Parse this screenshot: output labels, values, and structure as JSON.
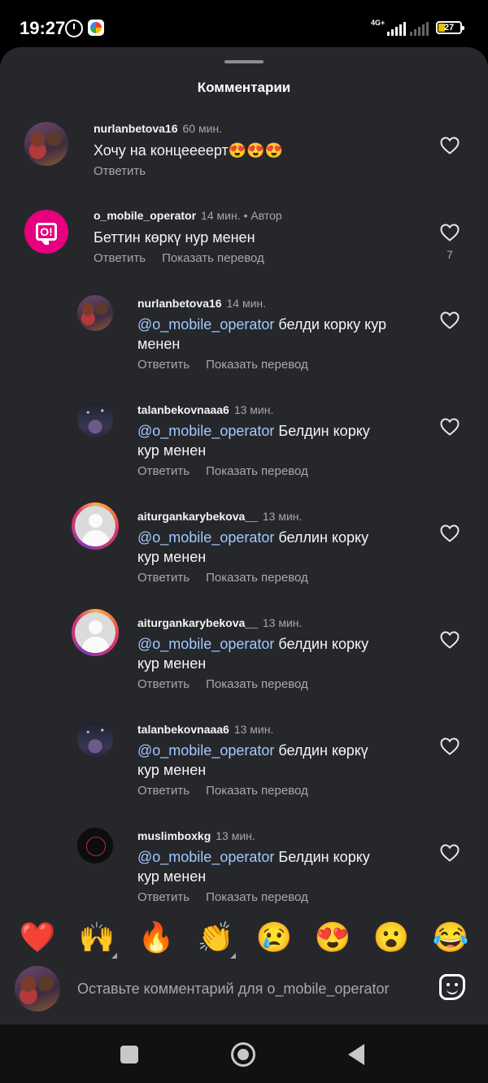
{
  "status_bar": {
    "time": "19:27",
    "network": "4G+",
    "battery": "27",
    "battery_level": 0.27
  },
  "sheet": {
    "title": "Комментарии"
  },
  "comments": [
    {
      "username": "nurlanbetova16",
      "time": "60 мин.",
      "text": "Хочу на концеееерт😍😍😍",
      "reply": "Ответить",
      "avatar": "couple-photo"
    },
    {
      "username": "o_mobile_operator",
      "time": "14 мин.",
      "author_label": "• Автор",
      "text": "Беттин көркү нур менен",
      "reply": "Ответить",
      "translate": "Показать перевод",
      "likes": "7",
      "avatar": "brand-logo"
    },
    {
      "username": "nurlanbetova16",
      "time": "14 мин.",
      "mention": "@o_mobile_operator",
      "text_line1": " белди корку кур",
      "text_line2": "менен",
      "reply": "Ответить",
      "translate": "Показать перевод",
      "avatar": "couple-photo"
    },
    {
      "username": "talanbekovnaaa6",
      "time": "13 мин.",
      "mention": "@o_mobile_operator",
      "text_line1": " Белдин корку",
      "text_line2": "кур менен",
      "reply": "Ответить",
      "translate": "Показать перевод",
      "avatar": "night-photo"
    },
    {
      "username": "aiturgankarybekova__",
      "time": "13 мин.",
      "mention": "@o_mobile_operator",
      "text_line1": " беллин корку",
      "text_line2": "кур менен",
      "reply": "Ответить",
      "translate": "Показать перевод",
      "avatar": "default-with-story"
    },
    {
      "username": "aiturgankarybekova__",
      "time": "13 мин.",
      "mention": "@o_mobile_operator",
      "text_line1": " белдин корку",
      "text_line2": "кур менен",
      "reply": "Ответить",
      "translate": "Показать перевод",
      "avatar": "default-with-story"
    },
    {
      "username": "talanbekovnaaa6",
      "time": "13 мин.",
      "mention": "@o_mobile_operator",
      "text_line1": " белдин көркү",
      "text_line2": "кур менен",
      "reply": "Ответить",
      "translate": "Показать перевод",
      "avatar": "night-photo"
    },
    {
      "username": "muslimboxkg",
      "time": "13 мин.",
      "mention": "@o_mobile_operator",
      "text_line1": " Белдин корку",
      "text_line2": "кур менен",
      "reply": "Ответить",
      "translate": "Показать перевод",
      "avatar": "dark-logo"
    }
  ],
  "emojis": [
    "❤️",
    "🙌",
    "🔥",
    "👏",
    "😢",
    "😍",
    "😮",
    "😂"
  ],
  "input": {
    "placeholder": "Оставьте комментарий для o_mobile_operator"
  },
  "icons": {
    "like": "heart-icon",
    "sticker": "sticker-icon",
    "alarm": "alarm-icon",
    "recents": "square-icon",
    "home": "circle-icon",
    "back": "triangle-icon"
  },
  "colors": {
    "sheet_bg": "#26272b",
    "mention": "#a3c8ff",
    "brand": "#e6007e",
    "muted": "#a8a8a8"
  }
}
